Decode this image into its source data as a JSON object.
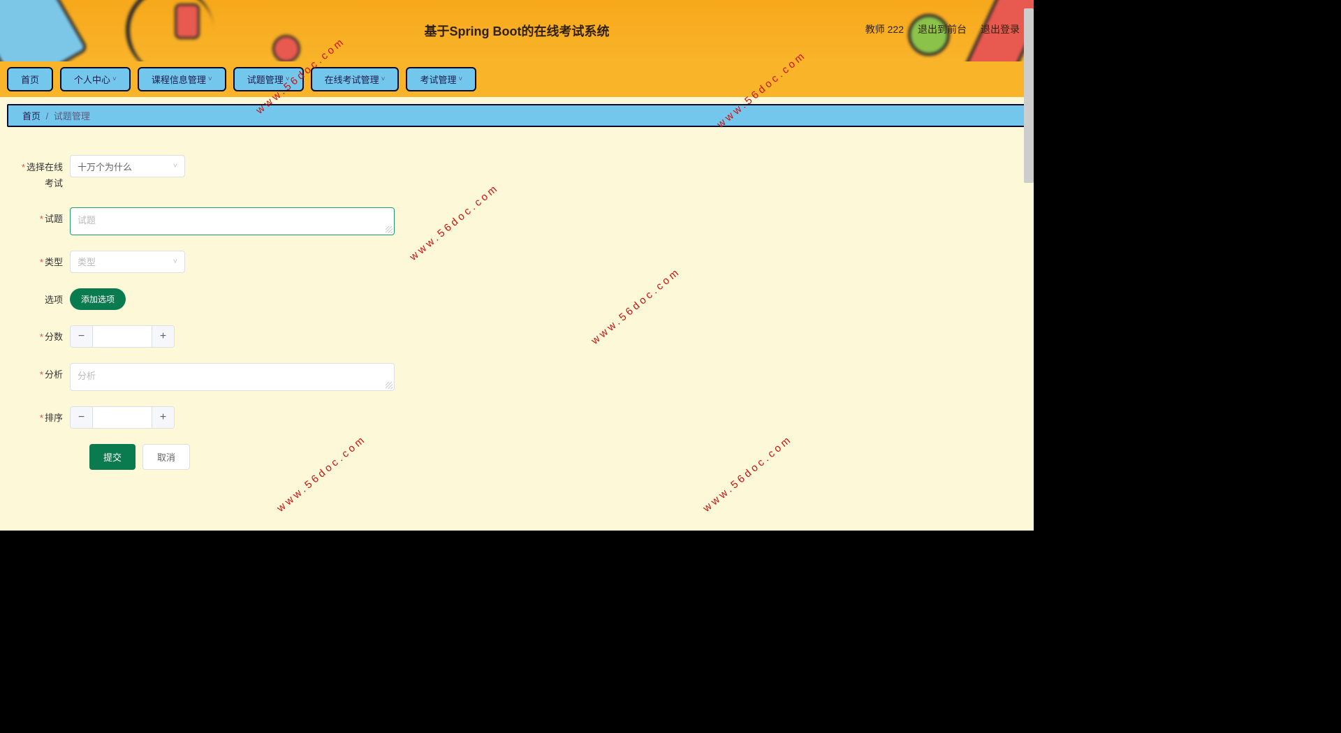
{
  "header": {
    "title": "基于Spring Boot的在线考试系统",
    "user_label": "教师 222",
    "exit_front": "退出到前台",
    "logout": "退出登录"
  },
  "nav": [
    {
      "label": "首页",
      "has_dropdown": false
    },
    {
      "label": "个人中心",
      "has_dropdown": true
    },
    {
      "label": "课程信息管理",
      "has_dropdown": true
    },
    {
      "label": "试题管理",
      "has_dropdown": true
    },
    {
      "label": "在线考试管理",
      "has_dropdown": true
    },
    {
      "label": "考试管理",
      "has_dropdown": true
    }
  ],
  "breadcrumb": {
    "home": "首页",
    "sep": "/",
    "current": "试题管理"
  },
  "form": {
    "select_exam_label": "选择在线考试",
    "select_exam_value": "十万个为什么",
    "question_label": "试题",
    "question_placeholder": "试题",
    "type_label": "类型",
    "type_placeholder": "类型",
    "options_label": "选项",
    "add_option_btn": "添加选项",
    "score_label": "分数",
    "score_value": "",
    "analysis_label": "分析",
    "analysis_placeholder": "分析",
    "sort_label": "排序",
    "sort_value": "",
    "submit": "提交",
    "cancel": "取消"
  },
  "watermark": "www.56doc.com"
}
